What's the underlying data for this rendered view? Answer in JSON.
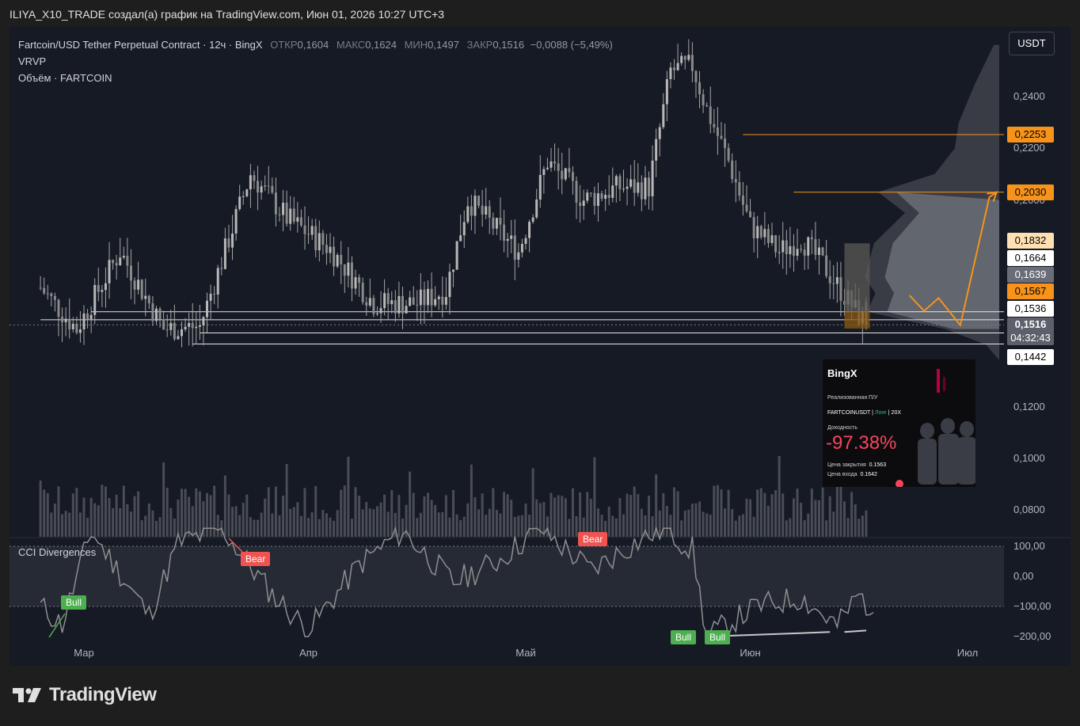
{
  "header": {
    "text": "ILIYA_X10_TRADE создал(а) график на TradingView.com, Июн 01, 2026 10:27 UTC+3"
  },
  "legend": {
    "symbol": "Fartcoin/USD Tether Perpetual Contract · 12ч · BingX",
    "open_label": "ОТКР",
    "open_value": "0,1604",
    "high_label": "МАКС",
    "high_value": "0,1624",
    "low_label": "МИН",
    "low_value": "0,1497",
    "close_label": "ЗАКР",
    "close_value": "0,1516",
    "change": "−0,0088 (−5,49%)",
    "indicator_1": "VRVP",
    "indicator_2": "Объём · FARTCOIN"
  },
  "currency_button": "USDT",
  "price_axis": {
    "ticks": [
      "0,2400",
      "0,2200",
      "0,2000",
      "0,1200",
      "0,1000",
      "0,0800"
    ]
  },
  "price_labels": [
    {
      "text": "0,2253",
      "bg": "#f7931a",
      "fg": "#000000"
    },
    {
      "text": "0,2030",
      "bg": "#f7931a",
      "fg": "#000000"
    },
    {
      "text": "0,1832",
      "bg": "#ffe0b2",
      "fg": "#000000"
    },
    {
      "text": "0,1664",
      "bg": "#ffffff",
      "fg": "#000000"
    },
    {
      "text": "0,1639",
      "bg": "#6a6d78",
      "fg": "#ffffff"
    },
    {
      "text": "0,1567",
      "bg": "#f7931a",
      "fg": "#000000"
    },
    {
      "text": "0,1536",
      "bg": "#ffffff",
      "fg": "#000000"
    },
    {
      "text": "0,1516",
      "bg": "#5d606b",
      "fg": "#ffffff"
    },
    {
      "text": "04:32:43",
      "bg": "#5d606b",
      "fg": "#ffffff"
    },
    {
      "text": "0,1442",
      "bg": "#ffffff",
      "fg": "#000000"
    }
  ],
  "time_axis": {
    "ticks": [
      "Мар",
      "Апр",
      "Май",
      "Июн",
      "Июл"
    ]
  },
  "cci": {
    "title": "CCI Divergences",
    "axis_ticks": [
      "100,00",
      "0,00",
      "−100,00",
      "−200,00"
    ],
    "signals": [
      "Bull",
      "Bear",
      "Bear",
      "Bull",
      "Bull"
    ]
  },
  "pnl_card": {
    "brand": "BingX",
    "label": "Реализованная П/У",
    "pair": "FARTCOINUSDT",
    "side": "Лонг",
    "leverage": "20X",
    "yield_label": "Доходность",
    "pnl": "-97.38%",
    "close_label": "Цена закрытия",
    "close_price": "0.1563",
    "entry_label": "Цена входа",
    "entry_price": "0.1642"
  },
  "brand_footer": "TradingView",
  "colors": {
    "background": "#161a25",
    "candle": "#a6a6a6",
    "accent_orange": "#f7931a",
    "bull": "#4caf50",
    "bear": "#f05350",
    "pnl_red": "#f6465d"
  },
  "chart_data": {
    "type": "candlestick",
    "symbol": "FARTCOINUSDT",
    "timeframe": "12ч",
    "ylim": [
      0.074,
      0.263
    ],
    "x_range": [
      "2026-02-23",
      "2026-07-06"
    ],
    "candle_interval_hours": 12,
    "candles": {
      "seed_close": 0.166,
      "closes_sampled": [
        [
          "2026-02-23",
          0.166
        ],
        [
          "2026-02-28",
          0.15
        ],
        [
          "2026-03-06",
          0.18
        ],
        [
          "2026-03-12",
          0.15
        ],
        [
          "2026-03-17",
          0.151
        ],
        [
          "2026-03-24",
          0.21
        ],
        [
          "2026-03-29",
          0.193
        ],
        [
          "2026-04-04",
          0.181
        ],
        [
          "2026-04-10",
          0.16
        ],
        [
          "2026-04-16",
          0.16
        ],
        [
          "2026-04-20",
          0.165
        ],
        [
          "2026-04-23",
          0.2
        ],
        [
          "2026-04-30",
          0.18
        ],
        [
          "2026-05-04",
          0.215
        ],
        [
          "2026-05-09",
          0.2
        ],
        [
          "2026-05-14",
          0.205
        ],
        [
          "2026-05-18",
          0.205
        ],
        [
          "2026-05-21",
          0.25
        ],
        [
          "2026-05-24",
          0.252
        ],
        [
          "2026-05-26",
          0.235
        ],
        [
          "2026-05-29",
          0.215
        ],
        [
          "2026-06-01",
          0.19
        ],
        [
          "2026-06-05",
          0.18
        ],
        [
          "2026-06-08",
          0.185
        ],
        [
          "2026-06-11",
          0.175
        ],
        [
          "2026-06-14",
          0.163
        ],
        [
          "2026-06-17",
          0.1516
        ]
      ],
      "last": {
        "open": 0.1604,
        "high": 0.1624,
        "low": 0.1497,
        "close": 0.1516
      }
    },
    "horizontal_levels": [
      {
        "price": 0.2253,
        "color": "orange",
        "from": "2026-05-31"
      },
      {
        "price": 0.203,
        "color": "orange",
        "from": "2026-06-07"
      },
      {
        "price": 0.1567,
        "color": "white",
        "from": "2026-03-02"
      },
      {
        "price": 0.1536,
        "color": "white",
        "from": "2026-02-23"
      },
      {
        "price": 0.1485,
        "color": "white",
        "from": "2026-03-17"
      },
      {
        "price": 0.1442,
        "color": "white",
        "from": "2026-03-16"
      }
    ],
    "projection_path": [
      [
        "2026-06-23",
        0.163
      ],
      [
        "2026-06-25",
        0.157
      ],
      [
        "2026-06-27",
        0.162
      ],
      [
        "2026-06-30",
        0.1515
      ],
      [
        "2026-07-04",
        0.201
      ],
      [
        "2026-07-05",
        0.203
      ]
    ],
    "volume_profile": {
      "price_range": [
        0.138,
        0.26
      ],
      "node_profile": [
        [
          0.26,
          0.04
        ],
        [
          0.245,
          0.18
        ],
        [
          0.23,
          0.3
        ],
        [
          0.22,
          0.33
        ],
        [
          0.21,
          0.48
        ],
        [
          0.203,
          0.9
        ],
        [
          0.195,
          0.7
        ],
        [
          0.1832,
          0.93
        ],
        [
          0.17,
          1.0
        ],
        [
          0.1639,
          0.92
        ],
        [
          0.1567,
          0.98
        ],
        [
          0.15,
          0.4
        ],
        [
          0.144,
          0.1
        ],
        [
          0.138,
          0.0
        ]
      ]
    },
    "volume_bars_shown": true,
    "cci": {
      "range": [
        -200,
        100
      ],
      "band": [
        -100,
        100
      ],
      "values_sampled": [
        [
          "2026-02-23",
          -100
        ],
        [
          "2026-02-26",
          -160
        ],
        [
          "2026-03-02",
          150
        ],
        [
          "2026-03-10",
          -130
        ],
        [
          "2026-03-14",
          110
        ],
        [
          "2026-03-20",
          160
        ],
        [
          "2026-03-27",
          -60
        ],
        [
          "2026-04-01",
          -180
        ],
        [
          "2026-04-08",
          40
        ],
        [
          "2026-04-14",
          150
        ],
        [
          "2026-04-21",
          -20
        ],
        [
          "2026-04-27",
          50
        ],
        [
          "2026-05-03",
          160
        ],
        [
          "2026-05-10",
          20
        ],
        [
          "2026-05-16",
          110
        ],
        [
          "2026-05-20",
          160
        ],
        [
          "2026-05-24",
          90
        ],
        [
          "2026-05-26",
          -200
        ],
        [
          "2026-06-02",
          -100
        ],
        [
          "2026-06-08",
          -70
        ],
        [
          "2026-06-13",
          -165
        ],
        [
          "2026-06-16",
          -60
        ],
        [
          "2026-06-18",
          -120
        ]
      ],
      "divergence_lines": [
        [
          [
            "2026-05-26",
            -200
          ],
          [
            "2026-06-12",
            -185
          ]
        ],
        [
          [
            "2026-06-14",
            -185
          ],
          [
            "2026-06-17",
            -180
          ]
        ]
      ]
    }
  }
}
